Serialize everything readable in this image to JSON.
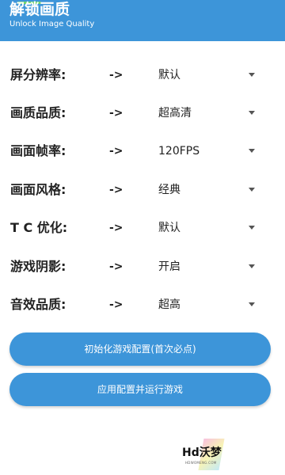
{
  "header": {
    "title": "解锁画质",
    "subtitle": "Unlock Image Quality"
  },
  "settings": [
    {
      "label": "屏分辨率:",
      "arrow": "->",
      "value": "默认"
    },
    {
      "label": "画质品质:",
      "arrow": "->",
      "value": "超高清"
    },
    {
      "label": "画面帧率:",
      "arrow": "->",
      "value": "120FPS"
    },
    {
      "label": "画面风格:",
      "arrow": "->",
      "value": "经典"
    },
    {
      "label": "T C 优化:",
      "arrow": "->",
      "value": "默认"
    },
    {
      "label": "游戏阴影:",
      "arrow": "->",
      "value": "开启"
    },
    {
      "label": "音效品质:",
      "arrow": "->",
      "value": "超高"
    }
  ],
  "buttons": {
    "init_label": "初始化游戏配置(首次必点)",
    "apply_label": "应用配置并运行游戏"
  },
  "watermark": {
    "text": "Hd沃梦",
    "small": "HDWOMENG.COM"
  },
  "colors": {
    "accent": "#3d95d9",
    "status_indicator": "#6fd36f"
  },
  "icons": {
    "dropdown": "chevron-down-icon"
  }
}
